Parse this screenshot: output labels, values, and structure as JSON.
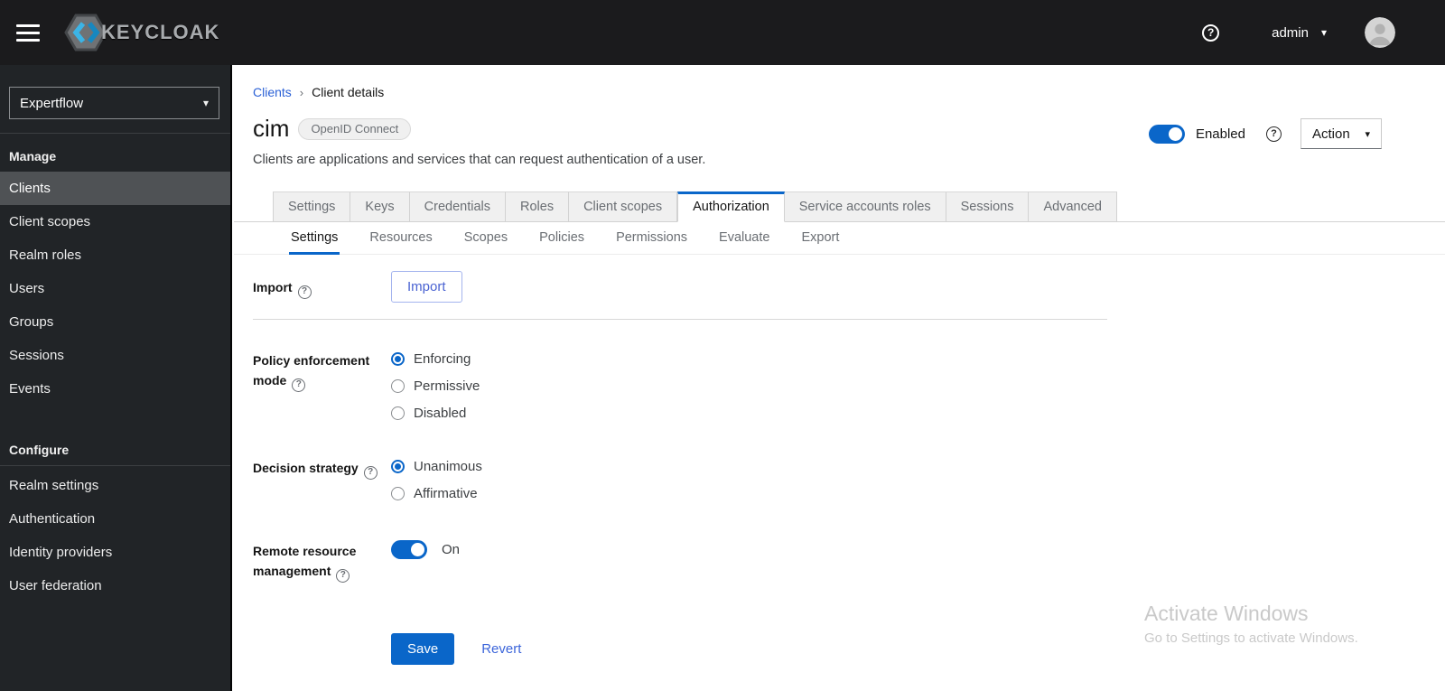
{
  "icons": {
    "question": "?",
    "caret_down": "▾",
    "chevron_right": "›"
  },
  "masthead": {
    "brand": "KEYCLOAK",
    "user": "admin"
  },
  "sidebar": {
    "realm": "Expertflow",
    "manage": {
      "label": "Manage",
      "items": [
        "Clients",
        "Client scopes",
        "Realm roles",
        "Users",
        "Groups",
        "Sessions",
        "Events"
      ],
      "active_item": "Clients"
    },
    "configure": {
      "label": "Configure",
      "items": [
        "Realm settings",
        "Authentication",
        "Identity providers",
        "User federation"
      ]
    }
  },
  "breadcrumb": {
    "items": [
      "Clients",
      "Client details"
    ]
  },
  "page_header": {
    "title": "cim",
    "badge": "OpenID Connect",
    "description": "Clients are applications and services that can request authentication of a user.",
    "enabled_label": "Enabled",
    "action_label": "Action"
  },
  "tabs": {
    "items": [
      "Settings",
      "Keys",
      "Credentials",
      "Roles",
      "Client scopes",
      "Authorization",
      "Service accounts roles",
      "Sessions",
      "Advanced"
    ],
    "active": "Authorization"
  },
  "subtabs": {
    "items": [
      "Settings",
      "Resources",
      "Scopes",
      "Policies",
      "Permissions",
      "Evaluate",
      "Export"
    ],
    "active": "Settings"
  },
  "form": {
    "import": {
      "label": "Import",
      "button_label": "Import"
    },
    "policy_enforcement": {
      "label": "Policy enforcement mode",
      "options": [
        "Enforcing",
        "Permissive",
        "Disabled"
      ],
      "selected": "Enforcing"
    },
    "decision_strategy": {
      "label": "Decision strategy",
      "options": [
        "Unanimous",
        "Affirmative"
      ],
      "selected": "Unanimous"
    },
    "remote_resource": {
      "label": "Remote resource management",
      "state": "On",
      "enabled": true
    },
    "save_label": "Save",
    "revert_label": "Revert"
  },
  "watermark": {
    "title": "Activate Windows",
    "subtitle": "Go to Settings to activate Windows."
  },
  "colors": {
    "primary": "#0a66c9",
    "masthead_bg": "#1b1b1d",
    "sidebar_bg": "#212427",
    "sidebar_active": "#4f5255",
    "link": "#2b61d6"
  }
}
